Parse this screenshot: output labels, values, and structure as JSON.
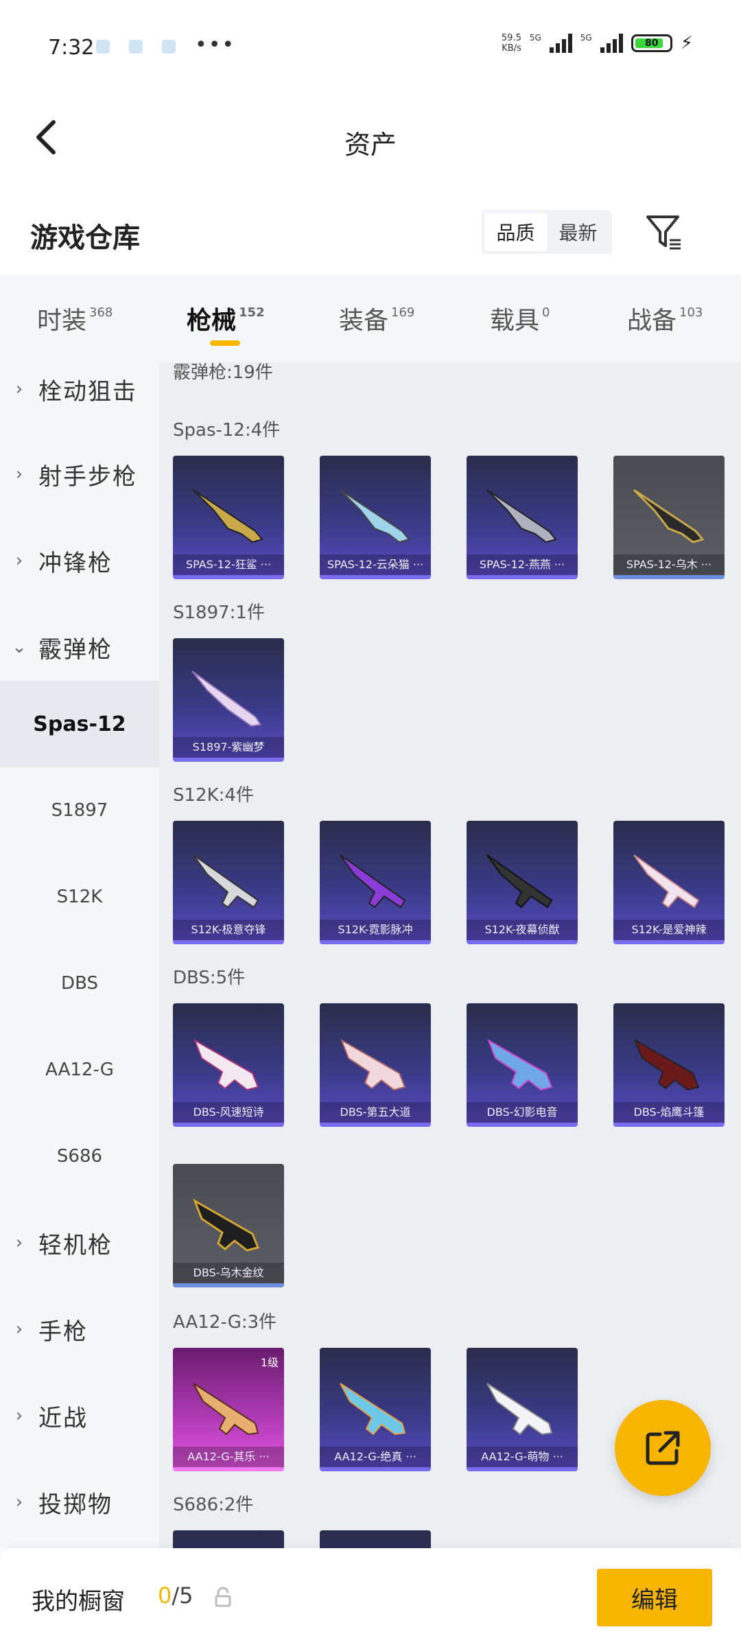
{
  "status": {
    "time": "7:32",
    "more": "•••",
    "net_speed_value": "59.5",
    "net_speed_unit": "KB/s",
    "sig1": "5G",
    "sig2": "5G",
    "battery": "80"
  },
  "header": {
    "title": "资产"
  },
  "warehouse": {
    "title": "游戏仓库",
    "sort_options": [
      "品质",
      "最新"
    ]
  },
  "tabs": [
    {
      "label": "时装",
      "count": "368"
    },
    {
      "label": "枪械",
      "count": "152"
    },
    {
      "label": "装备",
      "count": "169"
    },
    {
      "label": "载具",
      "count": "0"
    },
    {
      "label": "战备",
      "count": "103"
    }
  ],
  "sidebar": {
    "items": [
      {
        "label": "栓动狙击",
        "chevron": "›"
      },
      {
        "label": "射手步枪",
        "chevron": "›"
      },
      {
        "label": "冲锋枪",
        "chevron": "›"
      },
      {
        "label": "霰弹枪",
        "chevron": "⌄"
      }
    ],
    "subitems": [
      "Spas-12",
      "S1897",
      "S12K",
      "DBS",
      "AA12-G",
      "S686"
    ],
    "items_after": [
      {
        "label": "轻机枪",
        "chevron": "›"
      },
      {
        "label": "手枪",
        "chevron": "›"
      },
      {
        "label": "近战",
        "chevron": "›"
      },
      {
        "label": "投掷物",
        "chevron": "›"
      }
    ]
  },
  "groups": {
    "top": "霰弹枪:19件",
    "spas": {
      "title": "Spas-12:4件",
      "cards": [
        "SPAS-12-狂鲨 ···",
        "SPAS-12-云朵猫 ···",
        "SPAS-12-燕燕 ···",
        "SPAS-12-乌木 ···"
      ]
    },
    "s1897": {
      "title": "S1897:1件",
      "cards": [
        "S1897-紫幽梦"
      ]
    },
    "s12k": {
      "title": "S12K:4件",
      "cards": [
        "S12K-极意夺锋",
        "S12K-霓影脉冲",
        "S12K-夜幕侦猷",
        "S12K-是爱神辣"
      ]
    },
    "dbs": {
      "title": "DBS:5件",
      "cards": [
        "DBS-风速短诗",
        "DBS-第五大道",
        "DBS-幻影电音",
        "DBS-焰鹰斗篷",
        "DBS-乌木金纹"
      ]
    },
    "aa12": {
      "title": "AA12-G:3件",
      "level": "1级",
      "cards": [
        "AA12-G-其乐 ···",
        "AA12-G-绝真 ···",
        "AA12-G-萌物 ···"
      ]
    },
    "s686": {
      "title": "S686:2件"
    }
  },
  "bottom": {
    "showcase_label": "我的橱窗",
    "current": "0",
    "total": "/5",
    "edit_label": "编辑"
  }
}
